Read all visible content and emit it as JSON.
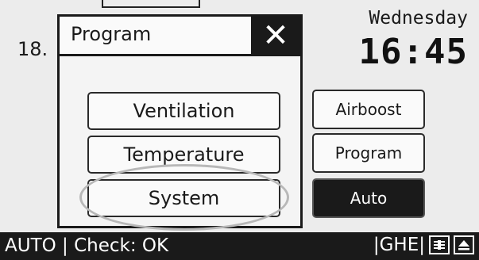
{
  "header": {
    "temperature_partial": "18.",
    "day": "Wednesday",
    "time": "16:45"
  },
  "dialog": {
    "title": "Program",
    "close_glyph": "✕",
    "items": [
      "Ventilation",
      "Temperature",
      "System"
    ],
    "highlighted_item": "System"
  },
  "side_buttons": {
    "airboost": "Airboost",
    "program": "Program",
    "auto": "Auto"
  },
  "status_bar": {
    "left_text": "AUTO | Check: OK",
    "ghe_text": "|GHE|",
    "icons": [
      "adjust-icon",
      "eject-icon"
    ]
  },
  "colors": {
    "screen_bg": "#ececec",
    "dark": "#1a1a1a",
    "highlight": "#b8b8b8"
  }
}
